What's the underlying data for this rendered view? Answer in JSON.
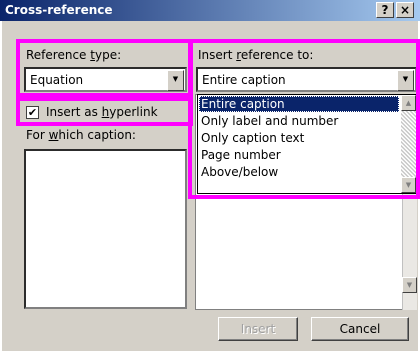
{
  "window": {
    "title": "Cross-reference",
    "help_label": "?",
    "close_label": "×"
  },
  "reference_type": {
    "label_before": "Reference ",
    "label_hotkey": "t",
    "label_after": "ype:",
    "value": "Equation"
  },
  "insert_reference_to": {
    "label_before": "Insert ",
    "label_hotkey": "r",
    "label_after": "eference to:",
    "value": "Entire caption",
    "options": [
      "Entire caption",
      "Only label and number",
      "Only caption text",
      "Page number",
      "Above/below"
    ],
    "selected_index": 0
  },
  "hyperlink": {
    "checked": true,
    "check_glyph": "✔",
    "label_before": "Insert as ",
    "label_hotkey": "h",
    "label_after": "yperlink"
  },
  "caption_list": {
    "label_before": "For ",
    "label_hotkey": "w",
    "label_after": "hich caption:"
  },
  "buttons": {
    "insert": "Insert",
    "cancel": "Cancel"
  },
  "icons": {
    "dropdown_arrow": "▼",
    "scroll_up": "▲",
    "scroll_down": "▼"
  },
  "colors": {
    "highlight": "#ff00ff",
    "title_gradient_start": "#0a246a",
    "title_gradient_end": "#a6caf0",
    "selection": "#0a246a",
    "face": "#d4d0c8"
  }
}
